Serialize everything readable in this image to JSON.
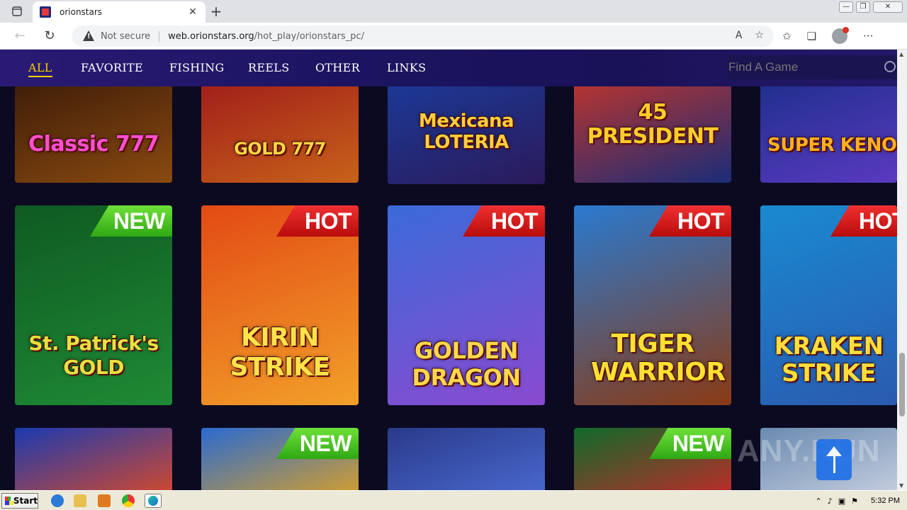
{
  "browser": {
    "tab_title": "orionstars",
    "tab_close": "✕",
    "new_tab": "+",
    "not_secure": "Not secure",
    "url_host": "web.orionstars.org",
    "url_path": "/hot_play/orionstars_pc/",
    "window_controls": {
      "minimize": "—",
      "maximize": "❐",
      "close": "✕"
    }
  },
  "site_nav": {
    "items": [
      {
        "label": "ALL",
        "active": true
      },
      {
        "label": "FAVORITE"
      },
      {
        "label": "FISHING"
      },
      {
        "label": "REELS"
      },
      {
        "label": "OTHER"
      },
      {
        "label": "LINKS"
      }
    ],
    "search_placeholder": "Find A Game"
  },
  "games": {
    "row1": [
      {
        "title": "Classic 777",
        "colors": [
          "#3a1a08",
          "#8a4a10"
        ],
        "text_color": "#ff4fd0"
      },
      {
        "title": "GOLD 777",
        "colors": [
          "#9e1a1a",
          "#c8621a"
        ],
        "text_color": "#ffd640"
      },
      {
        "title": "Mexicana LOTERIA",
        "colors": [
          "#1b3b9a",
          "#2b1a5a"
        ],
        "text_color": "#ffcf3a"
      },
      {
        "title": "45 PRESIDENT",
        "colors": [
          "#c2352a",
          "#1a2c78"
        ],
        "text_color": "#ffcc2a"
      },
      {
        "title": "SUPER KENO",
        "colors": [
          "#1c2e8a",
          "#5a3ac0"
        ],
        "text_color": "#ffb020"
      }
    ],
    "row2": [
      {
        "title": "St. Patrick's GOLD",
        "badge": "NEW",
        "colors": [
          "#0f5a22",
          "#1f8a35"
        ],
        "text_color": "#e8e040"
      },
      {
        "title": "KIRIN STRIKE",
        "badge": "HOT",
        "colors": [
          "#e24a14",
          "#f2a02a"
        ],
        "text_color": "#ffe24a"
      },
      {
        "title": "GOLDEN DRAGON",
        "badge": "HOT",
        "colors": [
          "#3b6ad8",
          "#8a4ad0"
        ],
        "text_color": "#ffd84a"
      },
      {
        "title": "TIGER WARRIOR",
        "badge": "HOT",
        "colors": [
          "#2a7ad0",
          "#8a3a14"
        ],
        "text_color": "#ffe030"
      },
      {
        "title": "KRAKEN STRIKE",
        "badge": "HOT",
        "colors": [
          "#1a8ad0",
          "#2a5ab0"
        ],
        "text_color": "#ffdd3a"
      }
    ],
    "row3": [
      {
        "badge": "",
        "colors": [
          "#1a3ab0",
          "#d84a2a"
        ]
      },
      {
        "badge": "NEW",
        "colors": [
          "#2a6ad0",
          "#d8a02a"
        ]
      },
      {
        "badge": "",
        "colors": [
          "#2a3a8a",
          "#4a6ad0"
        ]
      },
      {
        "badge": "NEW",
        "colors": [
          "#0f6a2a",
          "#c22a2a"
        ]
      },
      {
        "badge": "",
        "colors": [
          "#6a8ab0",
          "#c8d0e0"
        ]
      }
    ]
  },
  "watermark": "ANY.RUN",
  "taskbar": {
    "start_label": "Start",
    "clock": "5:32 PM"
  }
}
